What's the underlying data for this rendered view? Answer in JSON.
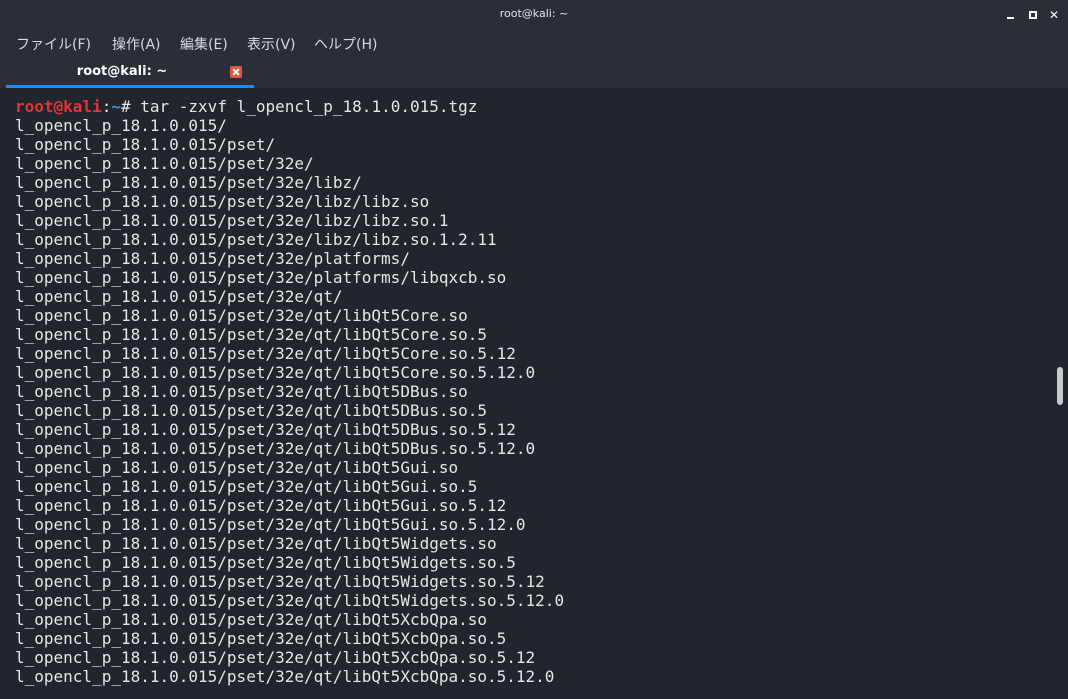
{
  "window": {
    "title": "root@kali: ~"
  },
  "menu": {
    "items": [
      "ファイル(F)",
      "操作(A)",
      "編集(E)",
      "表示(V)",
      "ヘルプ(H)"
    ]
  },
  "tab": {
    "label": "root@kali: ~"
  },
  "terminal": {
    "prompt": {
      "user_host": "root@kali",
      "separator": ":",
      "path": "~",
      "symbol": "# ",
      "command": "tar -zxvf l_opencl_p_18.1.0.015.tgz"
    },
    "output_lines": [
      "l_opencl_p_18.1.0.015/",
      "l_opencl_p_18.1.0.015/pset/",
      "l_opencl_p_18.1.0.015/pset/32e/",
      "l_opencl_p_18.1.0.015/pset/32e/libz/",
      "l_opencl_p_18.1.0.015/pset/32e/libz/libz.so",
      "l_opencl_p_18.1.0.015/pset/32e/libz/libz.so.1",
      "l_opencl_p_18.1.0.015/pset/32e/libz/libz.so.1.2.11",
      "l_opencl_p_18.1.0.015/pset/32e/platforms/",
      "l_opencl_p_18.1.0.015/pset/32e/platforms/libqxcb.so",
      "l_opencl_p_18.1.0.015/pset/32e/qt/",
      "l_opencl_p_18.1.0.015/pset/32e/qt/libQt5Core.so",
      "l_opencl_p_18.1.0.015/pset/32e/qt/libQt5Core.so.5",
      "l_opencl_p_18.1.0.015/pset/32e/qt/libQt5Core.so.5.12",
      "l_opencl_p_18.1.0.015/pset/32e/qt/libQt5Core.so.5.12.0",
      "l_opencl_p_18.1.0.015/pset/32e/qt/libQt5DBus.so",
      "l_opencl_p_18.1.0.015/pset/32e/qt/libQt5DBus.so.5",
      "l_opencl_p_18.1.0.015/pset/32e/qt/libQt5DBus.so.5.12",
      "l_opencl_p_18.1.0.015/pset/32e/qt/libQt5DBus.so.5.12.0",
      "l_opencl_p_18.1.0.015/pset/32e/qt/libQt5Gui.so",
      "l_opencl_p_18.1.0.015/pset/32e/qt/libQt5Gui.so.5",
      "l_opencl_p_18.1.0.015/pset/32e/qt/libQt5Gui.so.5.12",
      "l_opencl_p_18.1.0.015/pset/32e/qt/libQt5Gui.so.5.12.0",
      "l_opencl_p_18.1.0.015/pset/32e/qt/libQt5Widgets.so",
      "l_opencl_p_18.1.0.015/pset/32e/qt/libQt5Widgets.so.5",
      "l_opencl_p_18.1.0.015/pset/32e/qt/libQt5Widgets.so.5.12",
      "l_opencl_p_18.1.0.015/pset/32e/qt/libQt5Widgets.so.5.12.0",
      "l_opencl_p_18.1.0.015/pset/32e/qt/libQt5XcbQpa.so",
      "l_opencl_p_18.1.0.015/pset/32e/qt/libQt5XcbQpa.so.5",
      "l_opencl_p_18.1.0.015/pset/32e/qt/libQt5XcbQpa.so.5.12",
      "l_opencl_p_18.1.0.015/pset/32e/qt/libQt5XcbQpa.so.5.12.0"
    ]
  },
  "colors": {
    "background": "#21252c",
    "prompt_user": "#e0363b",
    "prompt_path": "#3b8eea",
    "text": "#e6e6e6",
    "tab_underline": "#1e8bf0",
    "tab_close": "#e25a45"
  }
}
